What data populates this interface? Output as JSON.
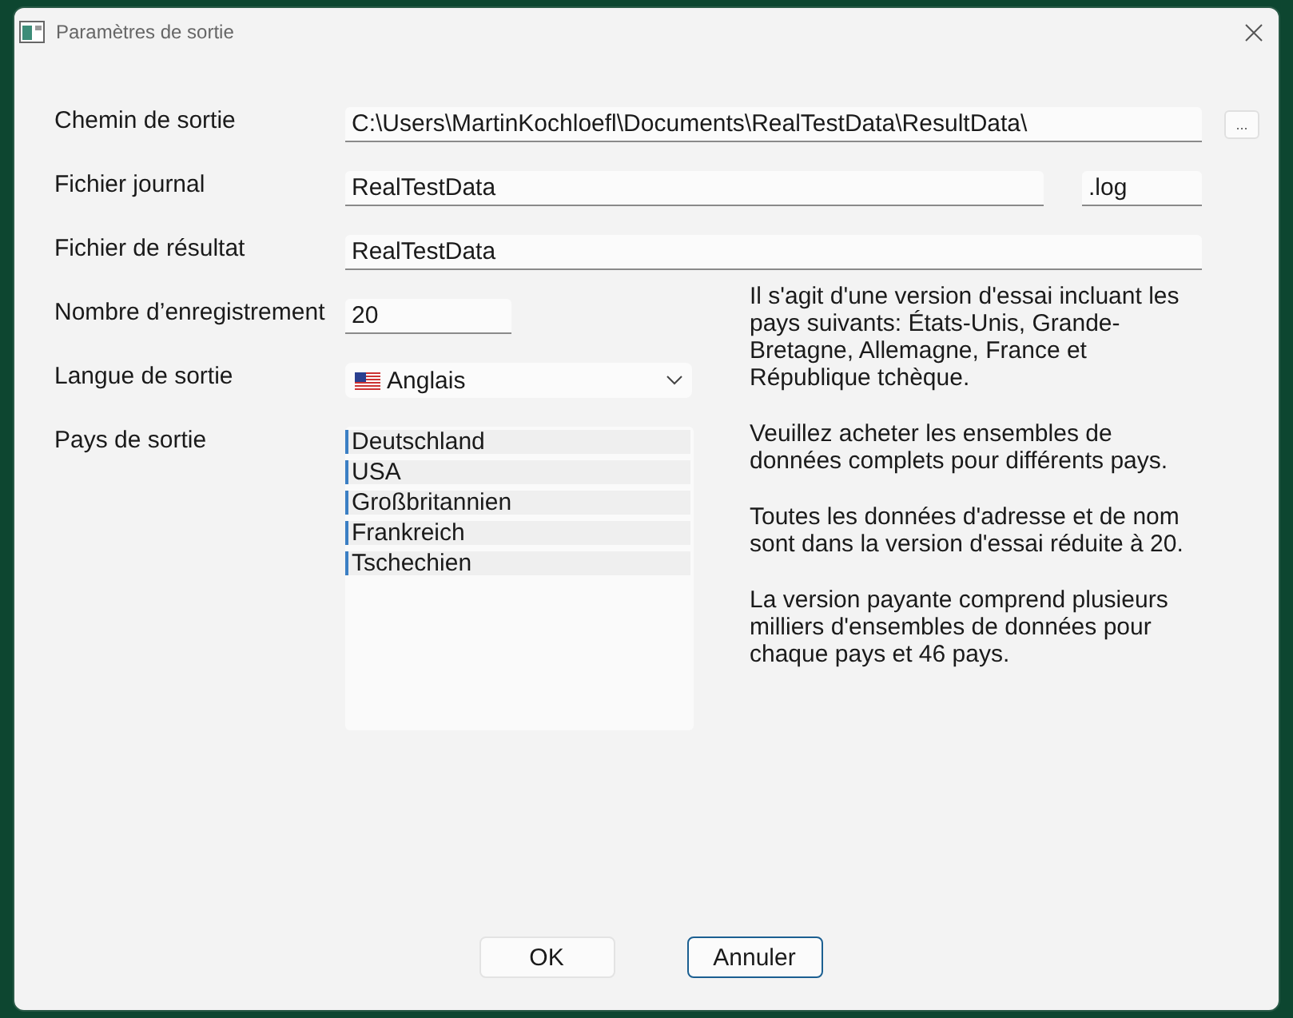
{
  "window": {
    "title": "Paramètres de sortie"
  },
  "fields": [
    {
      "kind": "path",
      "label": "Chemin de sortie",
      "value": "C:\\Users\\MartinKochloefl\\Documents\\RealTestData\\ResultData\\",
      "button": "..."
    },
    {
      "kind": "log",
      "label": "Fichier journal",
      "value": "RealTestData",
      "extension": ".log"
    },
    {
      "kind": "text",
      "label": "Fichier de résultat",
      "value": "RealTestData"
    }
  ],
  "record_count": {
    "label": "Nombre d’enregistrement",
    "value": "20"
  },
  "language": {
    "label": "Langue de sortie",
    "value": "Anglais"
  },
  "countries": {
    "label": "Pays de sortie",
    "items": [
      "Deutschland",
      "USA",
      "Großbritannien",
      "Frankreich",
      "Tschechien"
    ]
  },
  "notes": [
    "Il s'agit d'une version d'essai incluant les pays suivants: États-Unis, Grande-Bretagne, Allemagne, France et République tchèque.",
    "Veuillez acheter les ensembles de données complets pour différents pays.",
    "Toutes les données d'adresse et de nom sont dans la version d'essai réduite à 20.",
    "La version payante comprend plusieurs milliers d'ensembles de données pour chaque pays et 46 pays."
  ],
  "buttons": [
    {
      "label": "OK",
      "focused": false
    },
    {
      "label": "Annuler",
      "focused": true
    }
  ]
}
